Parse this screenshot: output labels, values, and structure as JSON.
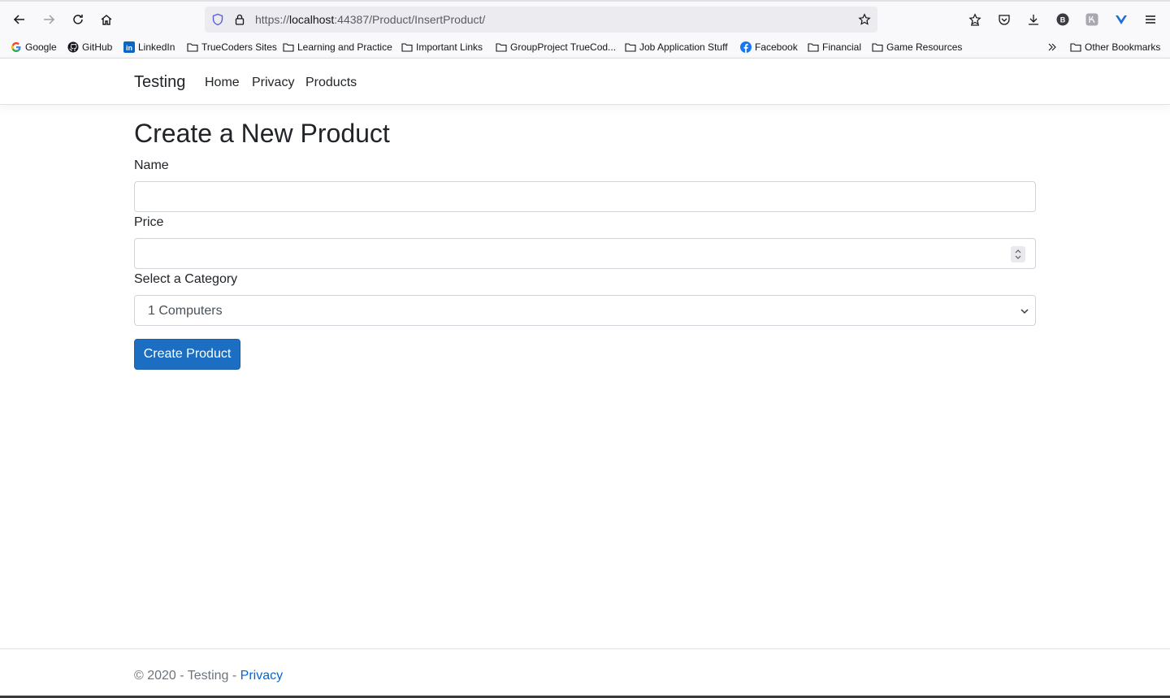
{
  "browser": {
    "url_prefix": "https://",
    "url_host": "localhost",
    "url_path": ":44387/Product/InsertProduct/",
    "bookmarks": [
      {
        "label": "Google",
        "icon": "google-icon"
      },
      {
        "label": "GitHub",
        "icon": "github-icon"
      },
      {
        "label": "LinkedIn",
        "icon": "linkedin-icon"
      },
      {
        "label": "TrueCoders Sites",
        "icon": "folder-icon"
      },
      {
        "label": "Learning and Practice",
        "icon": "folder-icon"
      },
      {
        "label": "Important Links",
        "icon": "folder-icon"
      },
      {
        "label": "GroupProject TrueCod...",
        "icon": "folder-icon"
      },
      {
        "label": "Job Application Stuff",
        "icon": "folder-icon"
      },
      {
        "label": "Facebook",
        "icon": "facebook-icon"
      },
      {
        "label": "Financial",
        "icon": "folder-icon"
      },
      {
        "label": "Game Resources",
        "icon": "folder-icon"
      }
    ],
    "other_bookmarks": "Other Bookmarks"
  },
  "navbar": {
    "brand": "Testing",
    "links": [
      "Home",
      "Privacy",
      "Products"
    ]
  },
  "form": {
    "title": "Create a New Product",
    "name_label": "Name",
    "name_value": "",
    "price_label": "Price",
    "price_value": "",
    "category_label": "Select a Category",
    "category_selected": "1 Computers",
    "submit_label": "Create Product"
  },
  "footer": {
    "text": "© 2020 - Testing - ",
    "link": "Privacy"
  },
  "colors": {
    "primary": "#1b6ec2",
    "link": "#0366d6"
  }
}
